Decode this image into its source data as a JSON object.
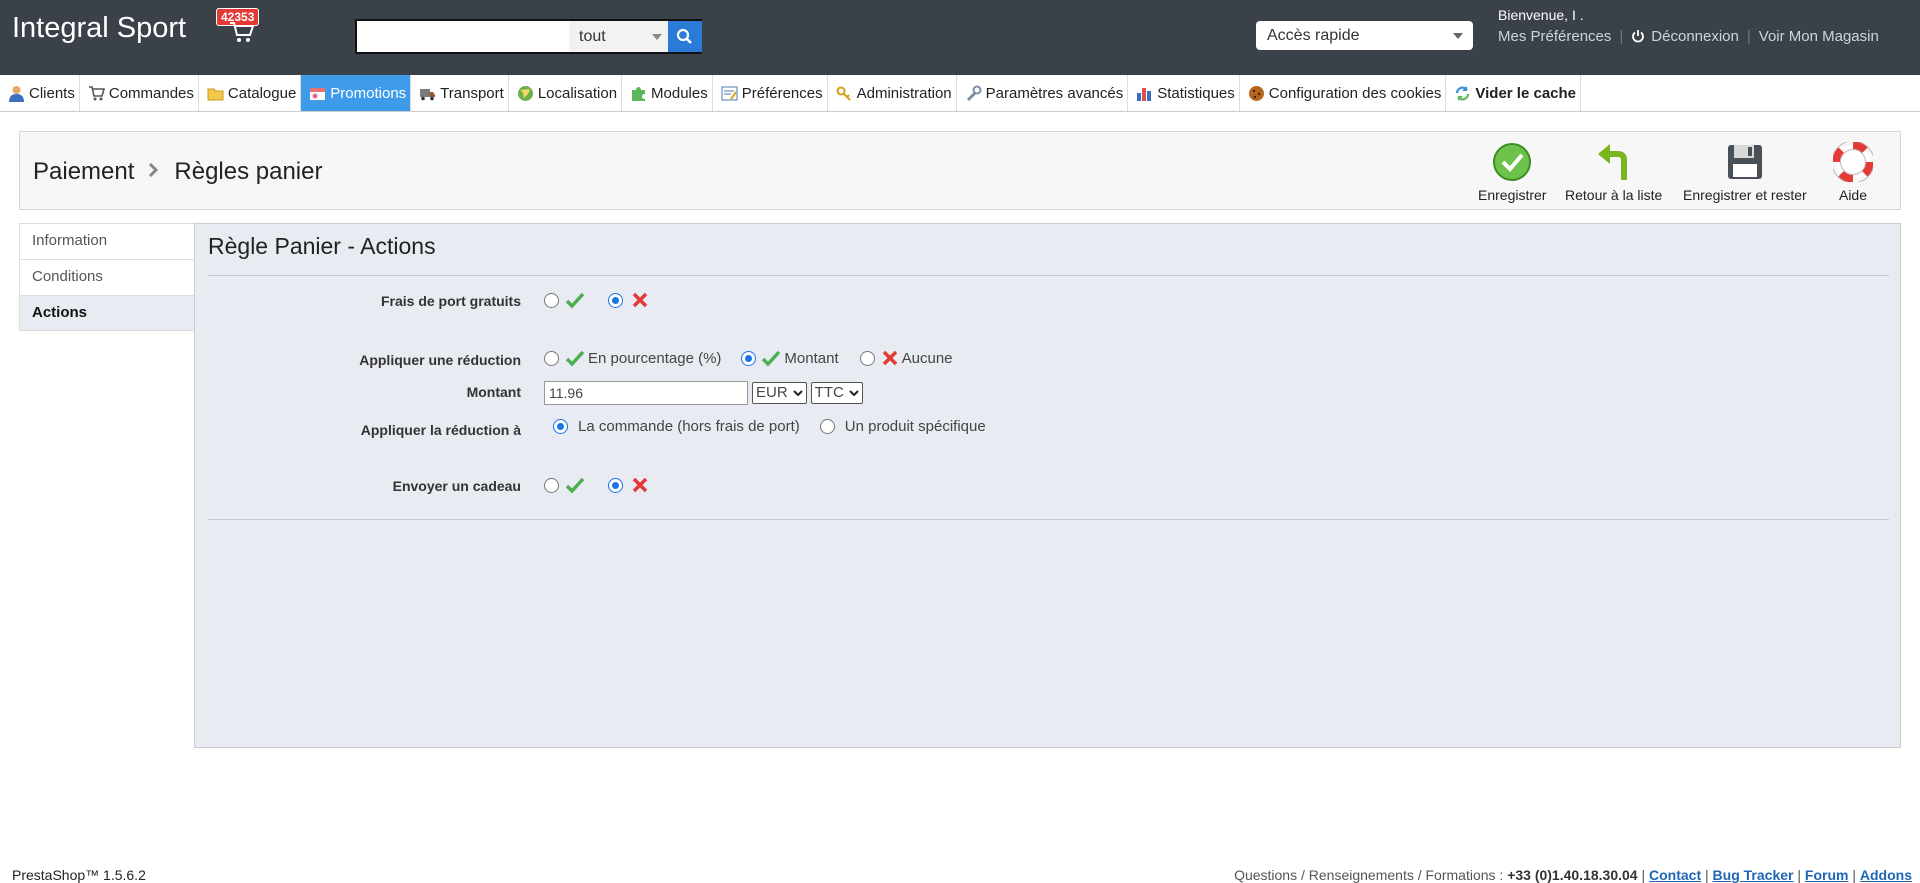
{
  "header": {
    "shop_name": "Integral Sport",
    "cart_count": "42353",
    "search": {
      "value": "",
      "scope": "tout"
    },
    "quick_access": "Accès rapide",
    "welcome": "Bienvenue, I .",
    "preferences_link": "Mes Préférences",
    "logout_link": "Déconnexion",
    "view_shop_link": "Voir Mon Magasin"
  },
  "nav": {
    "items": [
      {
        "label": "Clients",
        "icon": "clients-icon"
      },
      {
        "label": "Commandes",
        "icon": "cart-icon"
      },
      {
        "label": "Catalogue",
        "icon": "folder-icon"
      },
      {
        "label": "Promotions",
        "icon": "promotions-icon",
        "active": true
      },
      {
        "label": "Transport",
        "icon": "truck-icon"
      },
      {
        "label": "Localisation",
        "icon": "globe-icon"
      },
      {
        "label": "Modules",
        "icon": "puzzle-icon"
      },
      {
        "label": "Préférences",
        "icon": "preferences-icon"
      },
      {
        "label": "Administration",
        "icon": "key-icon"
      },
      {
        "label": "Paramètres avancés",
        "icon": "wrench-icon"
      },
      {
        "label": "Statistiques",
        "icon": "chart-icon"
      },
      {
        "label": "Configuration des cookies",
        "icon": "cookie-icon"
      },
      {
        "label": "Vider le cache",
        "icon": "refresh-icon",
        "bold": true
      }
    ]
  },
  "toolbar": {
    "breadcrumb": [
      "Paiement",
      "Règles panier"
    ],
    "buttons": {
      "save": "Enregistrer",
      "back": "Retour à la liste",
      "save_stay": "Enregistrer et rester",
      "help": "Aide"
    }
  },
  "tabs": [
    "Information",
    "Conditions",
    "Actions"
  ],
  "form": {
    "title": "Règle Panier - Actions",
    "free_shipping": {
      "label": "Frais de port gratuits",
      "value": "no"
    },
    "reduction": {
      "label": "Appliquer une réduction",
      "options": [
        "En pourcentage (%)",
        "Montant",
        "Aucune"
      ],
      "selected": "Montant"
    },
    "amount": {
      "label": "Montant",
      "value": "11.96",
      "currency": "EUR",
      "tax": "TTC"
    },
    "apply_to": {
      "label": "Appliquer la réduction à",
      "options": [
        "La commande (hors frais de port)",
        "Un produit spécifique"
      ],
      "selected": "La commande (hors frais de port)"
    },
    "gift": {
      "label": "Envoyer un cadeau",
      "value": "no"
    }
  },
  "footer": {
    "version": "PrestaShop™ 1.5.6.2",
    "contact_prefix": "Questions / Renseignements / Formations :",
    "phone": "+33 (0)1.40.18.30.04",
    "links": [
      "Contact",
      "Bug Tracker",
      "Forum",
      "Addons"
    ]
  },
  "colors": {
    "header_bg": "#3a4149",
    "nav_active": "#3d9be9",
    "content_bg": "#e8ebf2",
    "check_green": "#4caf50",
    "cross_red": "#e53935",
    "badge_red": "#e53935"
  }
}
